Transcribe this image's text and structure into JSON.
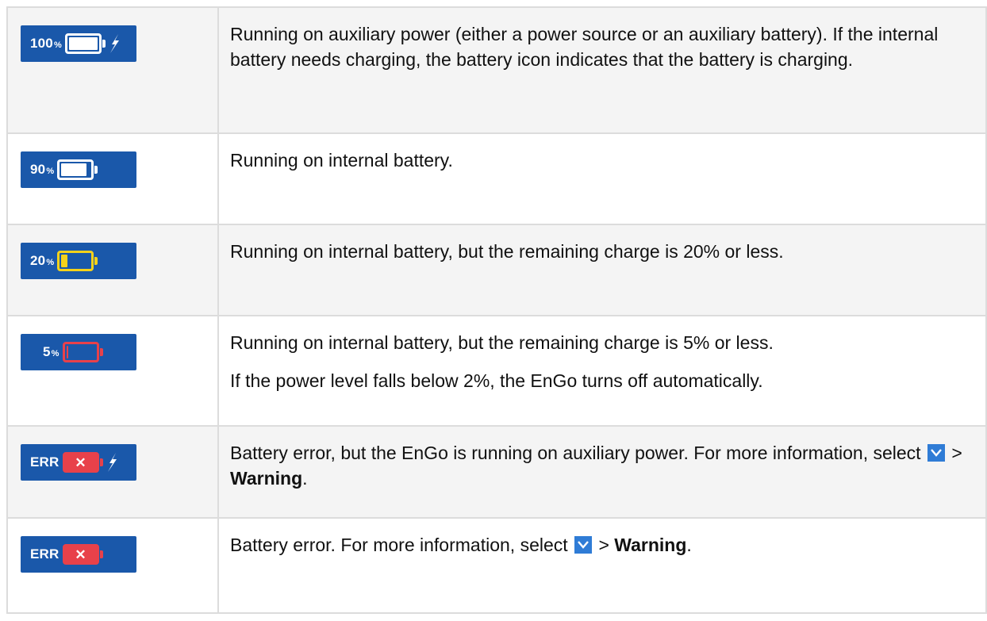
{
  "rows": [
    {
      "percent": "100",
      "percent_sign": "%",
      "icon": "battery-charging-auxiliary-icon",
      "description": "Running on auxiliary power (either a power source or an auxiliary battery). If the internal battery needs charging, the battery icon indicates that the battery is charging."
    },
    {
      "percent": "90",
      "percent_sign": "%",
      "icon": "battery-full-icon",
      "description": "Running on internal battery."
    },
    {
      "percent": "20",
      "percent_sign": "%",
      "icon": "battery-low-icon",
      "description": "Running on internal battery, but the remaining charge is 20% or less."
    },
    {
      "percent": "5",
      "percent_sign": "%",
      "icon": "battery-critical-icon",
      "description": "Running on internal battery, but the remaining charge is 5% or less.",
      "description_2": "If the power level falls below 2%, the EnGo turns off automatically."
    },
    {
      "percent": "ERR",
      "icon": "battery-error-auxiliary-icon",
      "err_mark": "✕",
      "description_prefix": "Battery error, but the EnGo is running on auxiliary power. For more information, select",
      "separator": ">",
      "bold": "Warning",
      "suffix": "."
    },
    {
      "percent": "ERR",
      "icon": "battery-error-icon",
      "err_mark": "✕",
      "description_prefix": "Battery error. For more information, select",
      "separator": ">",
      "bold": "Warning",
      "suffix": "."
    }
  ],
  "colors": {
    "icon_background": "#1a58aa",
    "battery_white": "#ffffff",
    "battery_yellow": "#f5d21b",
    "battery_red": "#e8414a",
    "chevron_button": "#2f7cd6",
    "shaded_row": "#f4f4f4",
    "grid_line": "#dcdcdc"
  }
}
